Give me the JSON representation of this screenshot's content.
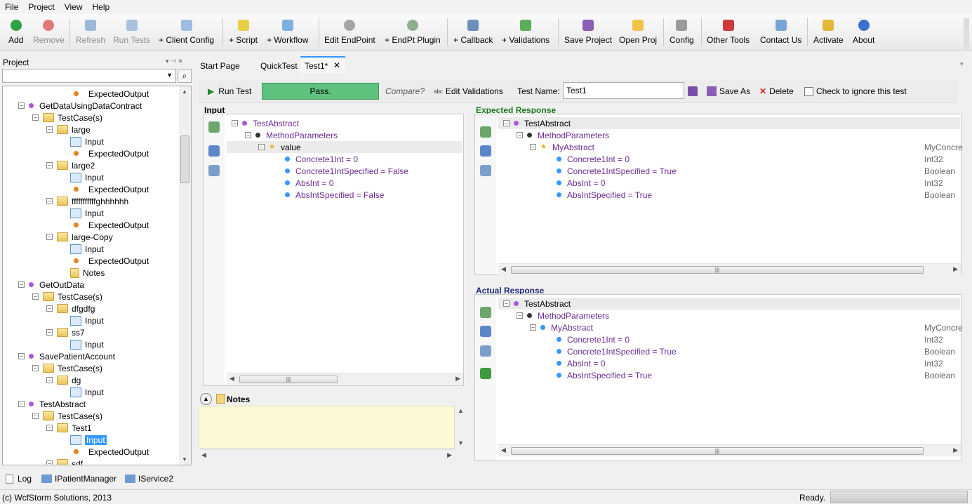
{
  "menu": [
    "File",
    "Project",
    "View",
    "Help"
  ],
  "toolbar": {
    "add": "Add",
    "remove": "Remove",
    "refresh": "Refresh",
    "run_tests": "Run Tests",
    "client_config": "+ Client Config",
    "script": "+ Script",
    "workflow": "+ Workflow",
    "edit_endpoint": "Edit EndPoint",
    "endpt_plugin": "+ EndPt Plugin",
    "callback": "+ Callback",
    "validations": "+ Validations",
    "save_project": "Save Project",
    "open_proj": "Open Proj",
    "config": "Config",
    "other_tools": "Other Tools",
    "contact_us": "Contact Us",
    "activate": "Activate",
    "about": "About"
  },
  "project_panel": {
    "title": "Project",
    "tree": [
      {
        "label": "ExpectedOutput",
        "kind": "out"
      },
      {
        "label": "GetDataUsingDataContract",
        "kind": "method"
      },
      {
        "label": "TestCase(s)",
        "kind": "folder"
      },
      {
        "label": "large",
        "kind": "folder"
      },
      {
        "label": "Input",
        "kind": "input"
      },
      {
        "label": "ExpectedOutput",
        "kind": "out"
      },
      {
        "label": "large2",
        "kind": "folder"
      },
      {
        "label": "Input",
        "kind": "input"
      },
      {
        "label": "ExpectedOutput",
        "kind": "out"
      },
      {
        "label": "fffffffffffghhhhhh",
        "kind": "folder"
      },
      {
        "label": "Input",
        "kind": "input"
      },
      {
        "label": "ExpectedOutput",
        "kind": "out"
      },
      {
        "label": "large-Copy",
        "kind": "folder"
      },
      {
        "label": "Input",
        "kind": "input"
      },
      {
        "label": "ExpectedOutput",
        "kind": "out"
      },
      {
        "label": "Notes",
        "kind": "notes"
      },
      {
        "label": "GetOutData",
        "kind": "method"
      },
      {
        "label": "TestCase(s)",
        "kind": "folder"
      },
      {
        "label": "dfgdfg",
        "kind": "folder"
      },
      {
        "label": "Input",
        "kind": "input"
      },
      {
        "label": "ss7",
        "kind": "folder"
      },
      {
        "label": "Input",
        "kind": "input"
      },
      {
        "label": "SavePatientAccount",
        "kind": "method"
      },
      {
        "label": "TestCase(s)",
        "kind": "folder"
      },
      {
        "label": "dg",
        "kind": "folder"
      },
      {
        "label": "Input",
        "kind": "input"
      },
      {
        "label": "TestAbstract",
        "kind": "method"
      },
      {
        "label": "TestCase(s)",
        "kind": "folder"
      },
      {
        "label": "Test1",
        "kind": "folder"
      },
      {
        "label": "Input",
        "kind": "input_sel"
      },
      {
        "label": "ExpectedOutput",
        "kind": "out"
      },
      {
        "label": "sdf",
        "kind": "folder"
      }
    ]
  },
  "tabs": {
    "start": "Start Page",
    "quick": "QuickTest",
    "test1": "Test1*",
    "close": "✕"
  },
  "testbar": {
    "run": "Run Test",
    "status": "Pass.",
    "compare": "Compare?",
    "edit_validations": "Edit Validations",
    "test_name_label": "Test Name:",
    "test_name_value": "Test1",
    "save_as": "Save As",
    "delete": "Delete",
    "ignore": "Check to ignore this test"
  },
  "input_panel": {
    "title": "Input",
    "nodes": [
      "TestAbstract",
      "MethodParameters",
      "value",
      "Concrete1Int = 0",
      "Concrete1IntSpecified = False",
      "AbsInt = 0",
      "AbsIntSpecified = False"
    ]
  },
  "notes": {
    "title": "Notes"
  },
  "expected": {
    "title": "Expected Response",
    "nodes": [
      "TestAbstract",
      "MethodParameters",
      "MyAbstract",
      "Concrete1Int = 0",
      "Concrete1IntSpecified = True",
      "AbsInt = 0",
      "AbsIntSpecified = True"
    ],
    "types": [
      "MyConcre",
      "Int32",
      "Boolean",
      "Int32",
      "Boolean"
    ]
  },
  "actual": {
    "title": "Actual Response",
    "nodes": [
      "TestAbstract",
      "MethodParameters",
      "MyAbstract",
      "Concrete1Int = 0",
      "Concrete1IntSpecified = True",
      "AbsInt = 0",
      "AbsIntSpecified = True"
    ],
    "types": [
      "MyConcre",
      "Int32",
      "Boolean",
      "Int32",
      "Boolean"
    ]
  },
  "bottom_tabs": [
    "Log",
    "IPatientManager",
    "IService2"
  ],
  "status": {
    "copyright": "(c) WcfStorm Solutions, 2013",
    "ready": "Ready."
  },
  "scroll_grip": "|||",
  "colors": {
    "pass": "#5fc27e",
    "purple": "#6b2c91",
    "accent": "#3399ff"
  }
}
